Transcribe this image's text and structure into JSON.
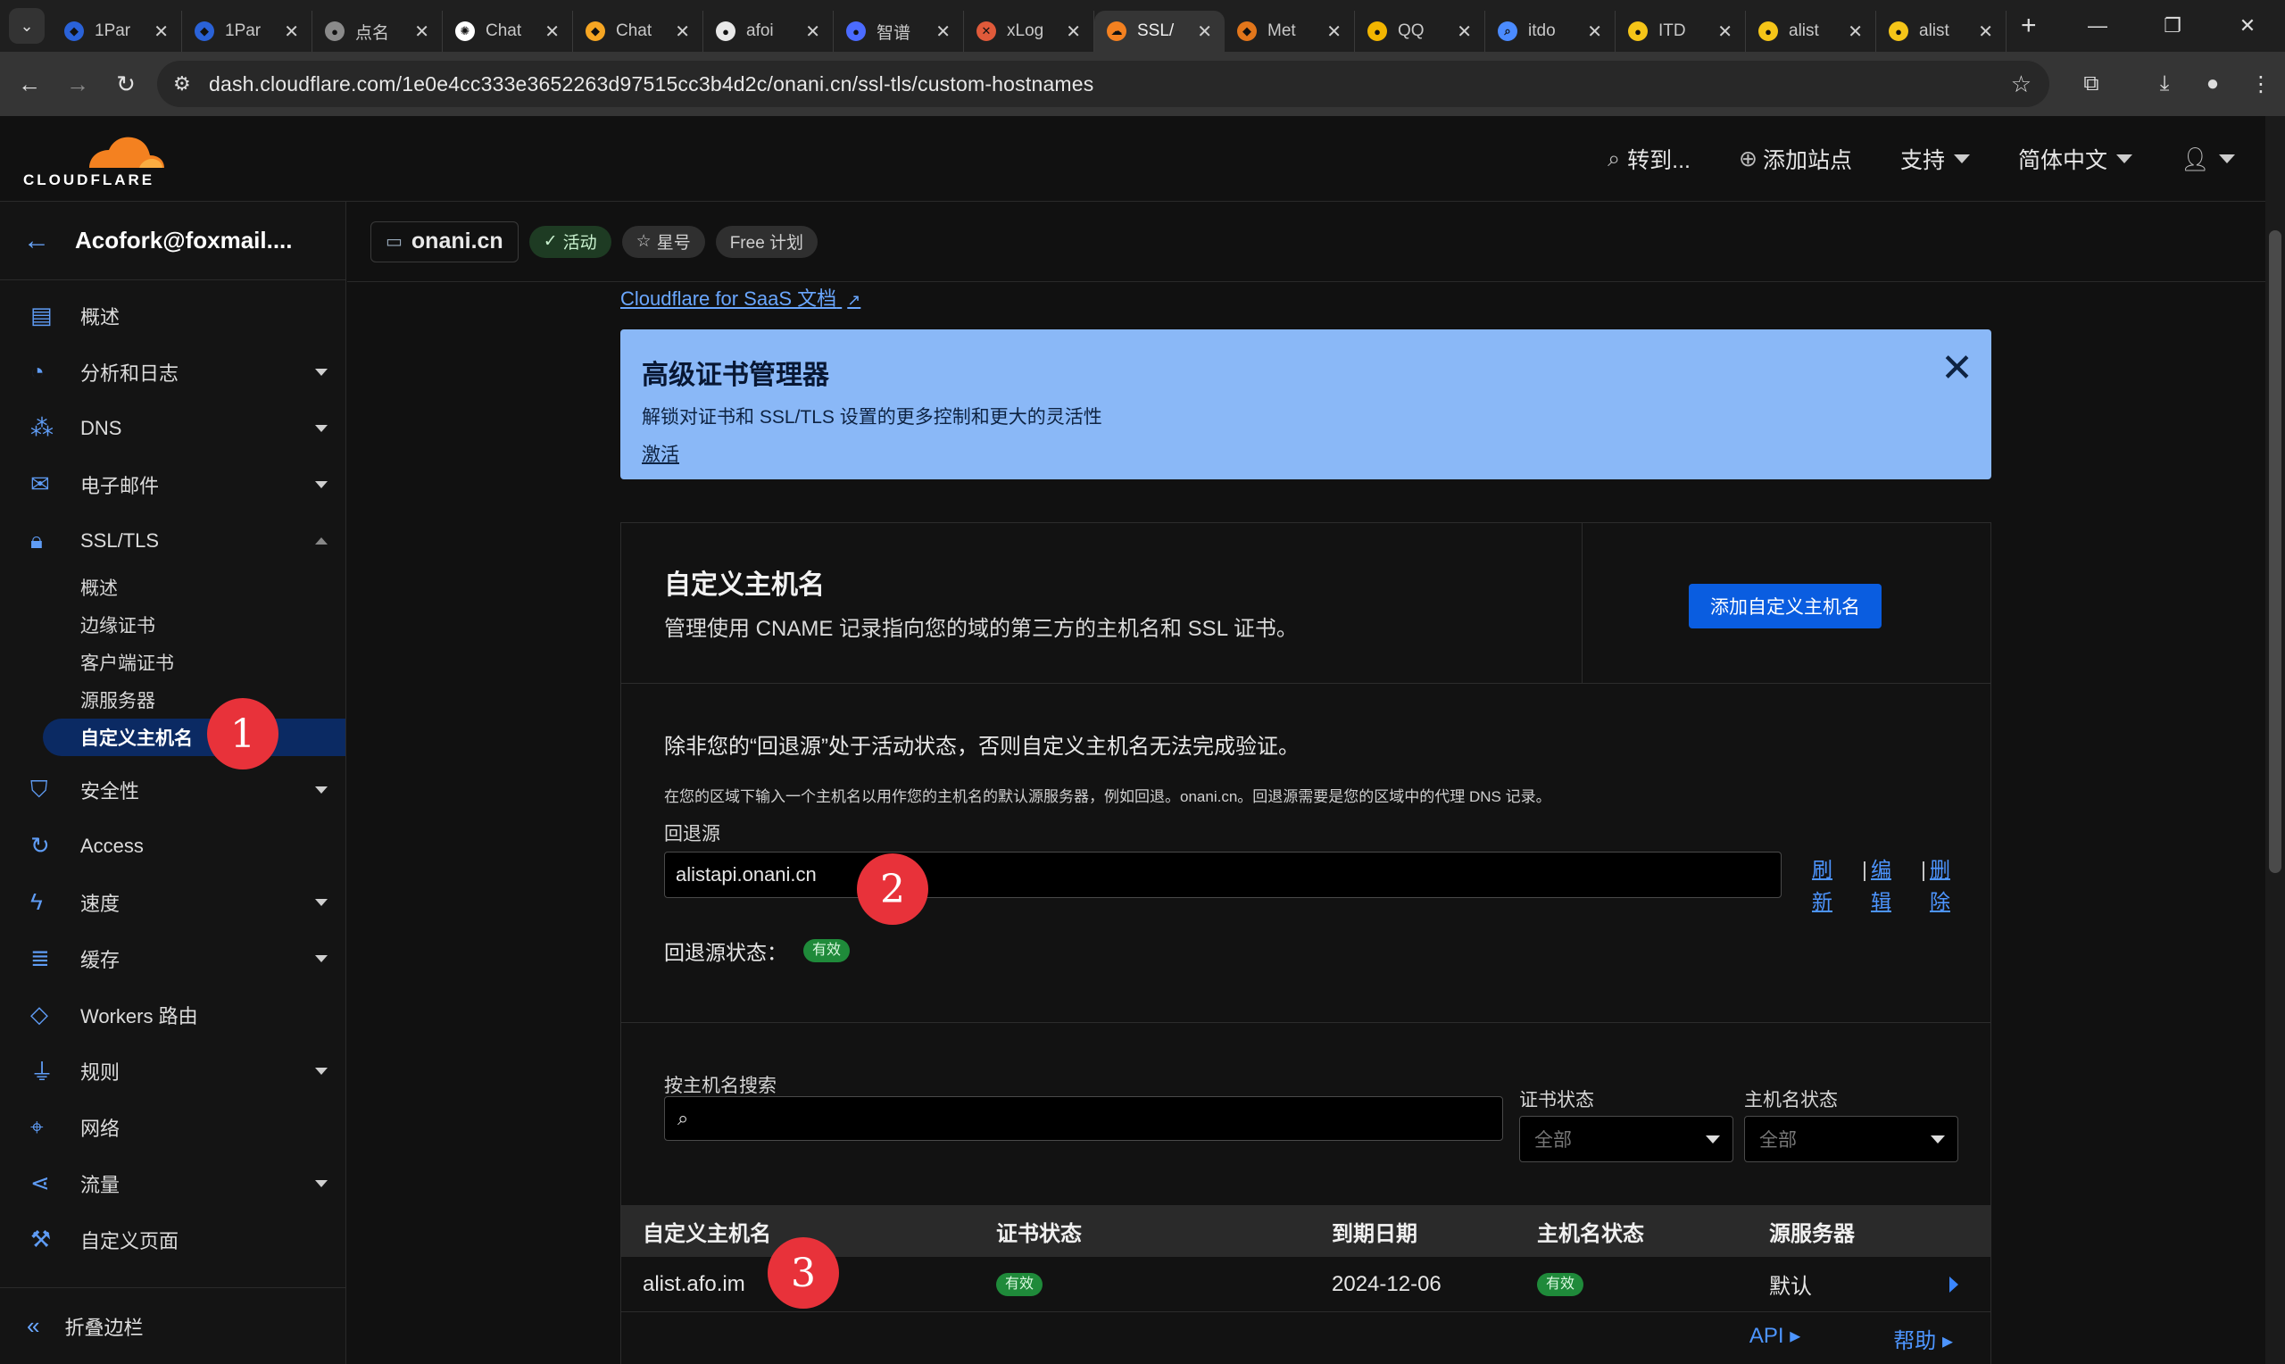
{
  "browser": {
    "tabs": [
      {
        "title": "1Par",
        "favicon_color": "#2a62d8",
        "favicon_glyph": "◆"
      },
      {
        "title": "1Par",
        "favicon_color": "#2a62d8",
        "favicon_glyph": "◆"
      },
      {
        "title": "点名",
        "favicon_color": "#8a8a8a",
        "favicon_glyph": "●"
      },
      {
        "title": "Chat",
        "favicon_color": "#ffffff",
        "favicon_glyph": "✺"
      },
      {
        "title": "Chat",
        "favicon_color": "#f6a623",
        "favicon_glyph": "◆"
      },
      {
        "title": "afoi",
        "favicon_color": "#e8e8e8",
        "favicon_glyph": "●"
      },
      {
        "title": "智谱",
        "favicon_color": "#4b6bff",
        "favicon_glyph": "●"
      },
      {
        "title": "xLog",
        "favicon_color": "#e05a3a",
        "favicon_glyph": "✕"
      },
      {
        "title": "SSL/",
        "favicon_color": "#f48120",
        "favicon_glyph": "☁",
        "active": true
      },
      {
        "title": "Met",
        "favicon_color": "#e2761b",
        "favicon_glyph": "◆"
      },
      {
        "title": "QQ",
        "favicon_color": "#f2b500",
        "favicon_glyph": "●"
      },
      {
        "title": "itdo",
        "favicon_color": "#4b8bff",
        "favicon_glyph": "⌕"
      },
      {
        "title": "ITD",
        "favicon_color": "#f5c518",
        "favicon_glyph": "●"
      },
      {
        "title": "alist",
        "favicon_color": "#f5c518",
        "favicon_glyph": "●"
      },
      {
        "title": "alist",
        "favicon_color": "#f5c518",
        "favicon_glyph": "●"
      }
    ],
    "url": "dash.cloudflare.com/1e0e4cc333e3652263d97515cc3b4d2c/onani.cn/ssl-tls/custom-hostnames"
  },
  "header": {
    "logo_text": "CLOUDFLARE",
    "goto": "转到...",
    "add_site": "添加站点",
    "support": "支持",
    "language": "简体中文"
  },
  "sidebar": {
    "account": "Acofork@foxmail....",
    "items": [
      {
        "label": "概述",
        "icon": "document-icon",
        "glyph": "▤"
      },
      {
        "label": "分析和日志",
        "icon": "chart-icon",
        "glyph": "◔",
        "expand": true
      },
      {
        "label": "DNS",
        "icon": "network-icon",
        "glyph": "⁂",
        "expand": true
      },
      {
        "label": "电子邮件",
        "icon": "mail-icon",
        "glyph": "✉",
        "expand": true
      },
      {
        "label": "SSL/TLS",
        "icon": "lock-icon",
        "glyph": "🔒︎",
        "expanded": true
      }
    ],
    "ssl_sub": [
      {
        "label": "概述"
      },
      {
        "label": "边缘证书"
      },
      {
        "label": "客户端证书"
      },
      {
        "label": "源服务器"
      },
      {
        "label": "自定义主机名",
        "active": true
      }
    ],
    "items2": [
      {
        "label": "安全性",
        "icon": "shield-icon",
        "glyph": "⛉",
        "expand": true
      },
      {
        "label": "Access",
        "icon": "access-icon",
        "glyph": "↻"
      },
      {
        "label": "速度",
        "icon": "lightning-icon",
        "glyph": "ϟ",
        "expand": true
      },
      {
        "label": "缓存",
        "icon": "database-icon",
        "glyph": "≣",
        "expand": true
      },
      {
        "label": "Workers 路由",
        "icon": "workers-icon",
        "glyph": "◇"
      },
      {
        "label": "规则",
        "icon": "funnel-icon",
        "glyph": "⏚",
        "expand": true
      },
      {
        "label": "网络",
        "icon": "location-icon",
        "glyph": "⌖"
      },
      {
        "label": "流量",
        "icon": "share-icon",
        "glyph": "⋖",
        "expand": true
      },
      {
        "label": "自定义页面",
        "icon": "wrench-icon",
        "glyph": "⚒"
      }
    ],
    "collapse": "折叠边栏"
  },
  "zone": {
    "name": "onani.cn",
    "status": "活动",
    "star": "星号",
    "plan": "Free 计划"
  },
  "main": {
    "saas_link": "Cloudflare for SaaS 文档",
    "banner": {
      "title": "高级证书管理器",
      "desc": "解锁对证书和 SSL/TLS 设置的更多控制和更大的灵活性",
      "link": "激活"
    },
    "card": {
      "title": "自定义主机名",
      "desc": "管理使用 CNAME 记录指向您的域的第三方的主机名和 SSL 证书。",
      "add_button": "添加自定义主机名"
    },
    "fallback": {
      "warning": "除非您的“回退源”处于活动状态，否则自定义主机名无法完成验证。",
      "help": "在您的区域下输入一个主机名以用作您的主机名的默认源服务器，例如回退。onani.cn。回退源需要是您的区域中的代理 DNS 记录。",
      "label": "回退源",
      "value": "alistapi.onani.cn",
      "refresh": "刷新",
      "edit": "编辑",
      "delete": "删除",
      "status_label": "回退源状态：",
      "status_value": "有效"
    },
    "search": {
      "label": "按主机名搜索",
      "cert_label": "证书状态",
      "cert_value": "全部",
      "host_label": "主机名状态",
      "host_value": "全部"
    },
    "table": {
      "headers": [
        "自定义主机名",
        "证书状态",
        "到期日期",
        "主机名状态",
        "源服务器"
      ],
      "rows": [
        {
          "hostname": "alist.afo.im",
          "cert": "有效",
          "expiry": "2024-12-06",
          "status": "有效",
          "origin": "默认"
        }
      ]
    },
    "footer": {
      "api": "API",
      "help": "帮助"
    }
  },
  "markers": [
    "1",
    "2",
    "3"
  ]
}
